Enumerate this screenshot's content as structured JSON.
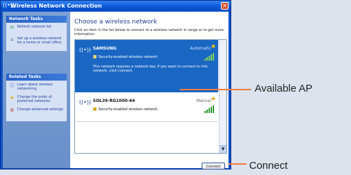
{
  "window": {
    "title": "Wireless Network Connection",
    "title_icon": "wireless-icon",
    "close_icon": "close-icon"
  },
  "sidebar": {
    "network_tasks": {
      "heading": "Network Tasks",
      "items": [
        {
          "label": "Refresh network list",
          "icon": "refresh-icon"
        },
        {
          "label": "Set up a wireless network for a home or small office",
          "icon": "setup-network-icon"
        }
      ]
    },
    "related_tasks": {
      "heading": "Related Tasks",
      "items": [
        {
          "label": "Learn about wireless networking",
          "icon": "info-icon"
        },
        {
          "label": "Change the order of preferred networks",
          "icon": "star-icon"
        },
        {
          "label": "Change advanced settings",
          "icon": "settings-icon"
        }
      ]
    }
  },
  "main": {
    "title": "Choose a wireless network",
    "instructions": "Click an item in the list below to connect to a wireless network in range or to get more information.",
    "networks": [
      {
        "name": "SAMSUNG",
        "mode": "Automatic",
        "security": "Security-enabled wireless network",
        "description": "This network requires a network key. If you want to connect to this network, click Connect.",
        "selected": true
      },
      {
        "name": "SOL39-RG1000-64",
        "mode": "Manual",
        "security": "Security-enabled wireless network",
        "selected": false
      }
    ],
    "connect_label": "Connect"
  },
  "annotations": {
    "available_ap": "Available AP",
    "connect": "Connect"
  },
  "colors": {
    "accent": "#f07b3f",
    "selected_row": "#1a66c3"
  }
}
